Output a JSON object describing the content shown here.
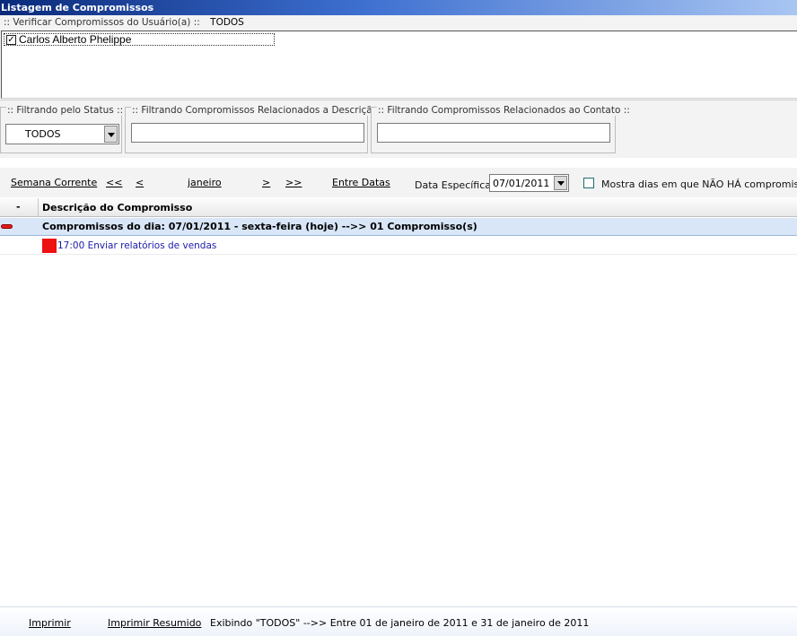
{
  "window": {
    "title": "Listagem de Compromissos"
  },
  "users": {
    "legend": ":: Verificar Compromissos do Usuário(a) ::",
    "selected": "TODOS",
    "items": [
      {
        "label": "Carlos Alberto Phelippe",
        "checked": true
      }
    ]
  },
  "filters": {
    "status": {
      "legend": ":: Filtrando pelo Status ::",
      "value": "TODOS"
    },
    "descricao": {
      "legend": ":: Filtrando Compromissos Relacionados a Descrição ::",
      "value": ""
    },
    "contato": {
      "legend": ":: Filtrando Compromissos Relacionados ao Contato ::",
      "value": ""
    }
  },
  "nav": {
    "semana": "Semana Corrente",
    "first": "<<",
    "prev": "<",
    "month": "janeiro",
    "next": ">",
    "last": ">>",
    "entre": "Entre Datas",
    "data_label": "Data Específica:",
    "data_value": "07/01/2011",
    "mostra_label": "Mostra dias em que NÃO HÁ compromissos?",
    "mostra_checked": false
  },
  "grid": {
    "col_minus": "-",
    "col_desc": "Descrição do Compromisso",
    "group_title": "Compromissos do dia: 07/01/2011 - sexta-feira (hoje)  -->> 01 Compromisso(s)",
    "rows": [
      {
        "text": "17:00 Enviar relatórios de vendas",
        "color": "#ee1111"
      }
    ]
  },
  "footer": {
    "print": "Imprimir",
    "print_summary": "Imprimir Resumido",
    "info": "Exibindo \"TODOS\" -->>  Entre 01 de janeiro de 2011 e 31 de janeiro de 2011"
  },
  "colors": {
    "accent": "#0a2a7a",
    "group_row": "#d8e6f8",
    "link": "#1a1aa8"
  }
}
